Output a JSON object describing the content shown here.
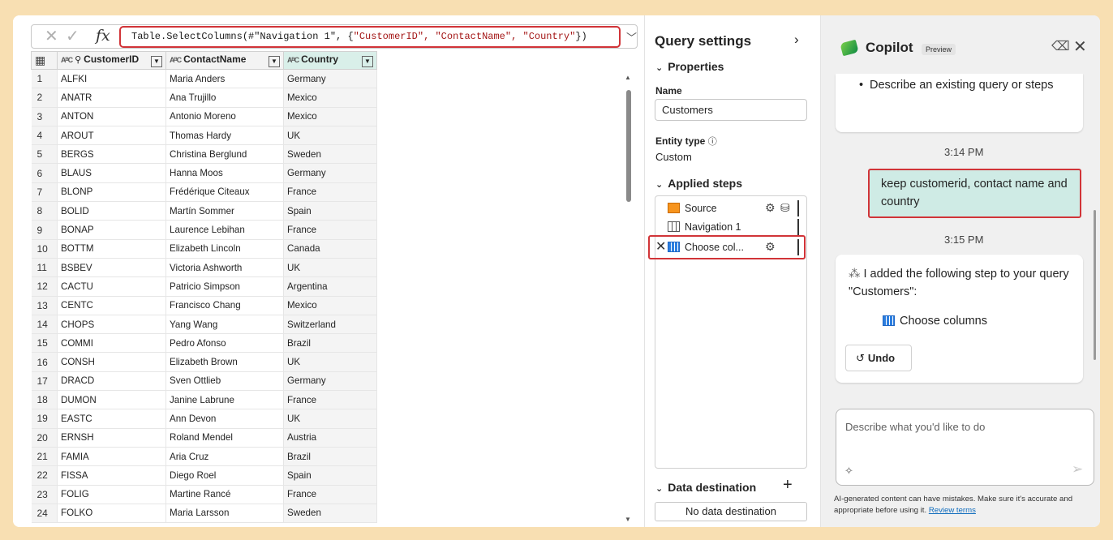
{
  "formula_bar": {
    "formula_prefix": "Table.SelectColumns(#\"Navigation 1\", {",
    "formula_args": "\"CustomerID\", \"ContactName\", \"Country\"",
    "formula_suffix": "})",
    "fx_label": "fx"
  },
  "grid": {
    "columns": [
      "CustomerID",
      "ContactName",
      "Country"
    ],
    "rows": [
      [
        "1",
        "ALFKI",
        "Maria Anders",
        "Germany"
      ],
      [
        "2",
        "ANATR",
        "Ana Trujillo",
        "Mexico"
      ],
      [
        "3",
        "ANTON",
        "Antonio Moreno",
        "Mexico"
      ],
      [
        "4",
        "AROUT",
        "Thomas Hardy",
        "UK"
      ],
      [
        "5",
        "BERGS",
        "Christina Berglund",
        "Sweden"
      ],
      [
        "6",
        "BLAUS",
        "Hanna Moos",
        "Germany"
      ],
      [
        "7",
        "BLONP",
        "Frédérique Citeaux",
        "France"
      ],
      [
        "8",
        "BOLID",
        "Martín Sommer",
        "Spain"
      ],
      [
        "9",
        "BONAP",
        "Laurence Lebihan",
        "France"
      ],
      [
        "10",
        "BOTTM",
        "Elizabeth Lincoln",
        "Canada"
      ],
      [
        "11",
        "BSBEV",
        "Victoria Ashworth",
        "UK"
      ],
      [
        "12",
        "CACTU",
        "Patricio Simpson",
        "Argentina"
      ],
      [
        "13",
        "CENTC",
        "Francisco Chang",
        "Mexico"
      ],
      [
        "14",
        "CHOPS",
        "Yang Wang",
        "Switzerland"
      ],
      [
        "15",
        "COMMI",
        "Pedro Afonso",
        "Brazil"
      ],
      [
        "16",
        "CONSH",
        "Elizabeth Brown",
        "UK"
      ],
      [
        "17",
        "DRACD",
        "Sven Ottlieb",
        "Germany"
      ],
      [
        "18",
        "DUMON",
        "Janine Labrune",
        "France"
      ],
      [
        "19",
        "EASTC",
        "Ann Devon",
        "UK"
      ],
      [
        "20",
        "ERNSH",
        "Roland Mendel",
        "Austria"
      ],
      [
        "21",
        "FAMIA",
        "Aria Cruz",
        "Brazil"
      ],
      [
        "22",
        "FISSA",
        "Diego Roel",
        "Spain"
      ],
      [
        "23",
        "FOLIG",
        "Martine Rancé",
        "France"
      ],
      [
        "24",
        "FOLKO",
        "Maria Larsson",
        "Sweden"
      ]
    ]
  },
  "query_settings": {
    "title": "Query settings",
    "properties_header": "Properties",
    "name_label": "Name",
    "name_value": "Customers",
    "entity_type_label": "Entity type",
    "entity_type_value": "Custom",
    "applied_steps_header": "Applied steps",
    "steps": [
      "Source",
      "Navigation 1",
      "Choose col..."
    ],
    "data_destination_header": "Data destination",
    "data_destination_value": "No data destination"
  },
  "copilot": {
    "title": "Copilot",
    "badge": "Preview",
    "prev_bullet": "Describe an existing query or steps",
    "time1": "3:14 PM",
    "user_message": "keep customerid, contact name and country",
    "time2": "3:15 PM",
    "ai_message": "I added the following step to your query \"Customers\":",
    "ai_step": "Choose columns",
    "undo_label": "Undo",
    "input_placeholder": "Describe what you'd like to do",
    "disclaimer": "AI-generated content can have mistakes. Make sure it's accurate and appropriate before using it.",
    "review_terms": "Review terms"
  },
  "colors": {
    "highlight_red": "#d13438",
    "user_bubble": "#cfebe5",
    "country_header": "#d9efe9",
    "background": "#f8dfb2"
  }
}
